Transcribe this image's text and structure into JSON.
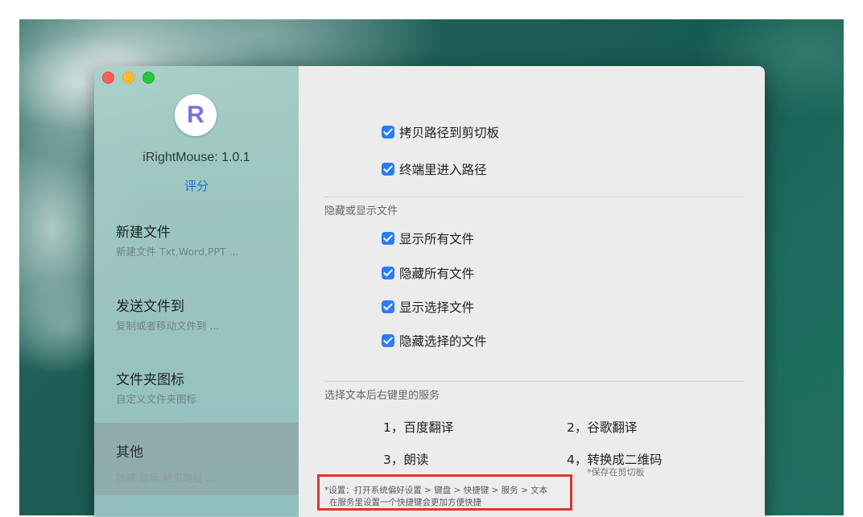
{
  "app": {
    "logo_letter": "R",
    "title": "iRightMouse: 1.0.1",
    "rate_label": "评分"
  },
  "sidebar": {
    "items": [
      {
        "title": "新建文件",
        "subtitle": "新建文件 Txt,Word,PPT ..."
      },
      {
        "title": "发送文件到",
        "subtitle": "复制或者移动文件到 ..."
      },
      {
        "title": "文件夹图标",
        "subtitle": "自定义文件夹图标"
      },
      {
        "title": "其他",
        "subtitle": "隐藏,显示,拷贝路径 ..."
      }
    ],
    "selected": "其他"
  },
  "content": {
    "path_options": [
      {
        "label": "拷贝路径到剪切板",
        "checked": true
      },
      {
        "label": "终端里进入路径",
        "checked": true
      }
    ],
    "hide_show_section": {
      "label": "隐藏或显示文件",
      "options": [
        {
          "label": "显示所有文件",
          "checked": true
        },
        {
          "label": "隐藏所有文件",
          "checked": true
        },
        {
          "label": "显示选择文件",
          "checked": true
        },
        {
          "label": "隐藏选择的文件",
          "checked": true
        }
      ]
    },
    "services_section": {
      "label": "选择文本后右键里的服务",
      "services": [
        "1，百度翻译",
        "2，谷歌翻译",
        "3，朗读",
        "4，转换成二维码"
      ],
      "note": "*保存在剪切板"
    },
    "hint": {
      "line1": "*设置：打开系统偏好设置 > 键盘 > 快捷键 > 服务 > 文本",
      "line2": "在服务里设置一个快捷键会更加方便快捷"
    }
  },
  "colors": {
    "accent": "#2c7cf6",
    "link": "#1f6fd6",
    "highlight_border": "#d63a2e",
    "traffic_close": "#fe5f57",
    "traffic_minimize": "#febc2e",
    "traffic_maximize": "#28c840"
  }
}
